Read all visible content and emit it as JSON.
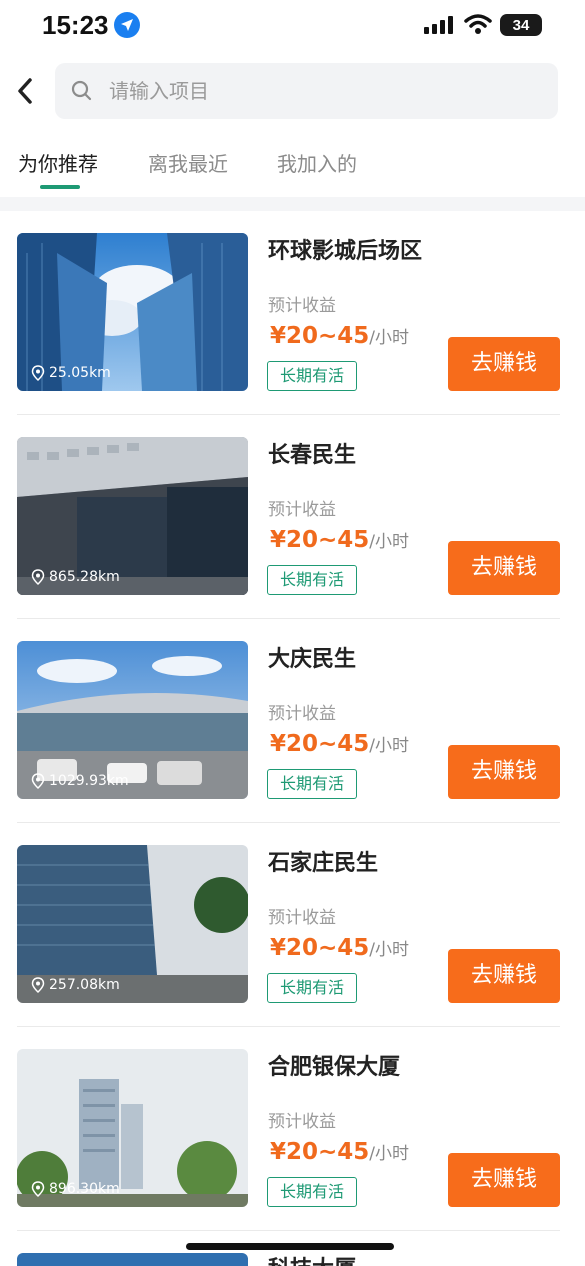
{
  "status_bar": {
    "time": "15:23",
    "battery": "34"
  },
  "search": {
    "placeholder": "请输入项目"
  },
  "tabs": [
    {
      "label": "为你推荐",
      "active": true
    },
    {
      "label": "离我最近",
      "active": false
    },
    {
      "label": "我加入的",
      "active": false
    }
  ],
  "items": [
    {
      "title": "环球影城后场区",
      "distance": "25.05km",
      "earnings_label": "预计收益",
      "price": "¥20~45",
      "unit": "/小时",
      "tag": "长期有活",
      "button": "去赚钱"
    },
    {
      "title": "长春民生",
      "distance": "865.28km",
      "earnings_label": "预计收益",
      "price": "¥20~45",
      "unit": "/小时",
      "tag": "长期有活",
      "button": "去赚钱"
    },
    {
      "title": "大庆民生",
      "distance": "1029.93km",
      "earnings_label": "预计收益",
      "price": "¥20~45",
      "unit": "/小时",
      "tag": "长期有活",
      "button": "去赚钱"
    },
    {
      "title": "石家庄民生",
      "distance": "257.08km",
      "earnings_label": "预计收益",
      "price": "¥20~45",
      "unit": "/小时",
      "tag": "长期有活",
      "button": "去赚钱"
    },
    {
      "title": "合肥银保大厦",
      "distance": "896.30km",
      "earnings_label": "预计收益",
      "price": "¥20~45",
      "unit": "/小时",
      "tag": "长期有活",
      "button": "去赚钱"
    }
  ],
  "partial_item": {
    "title": "科技大厦"
  },
  "colors": {
    "accent_green": "#1e9a74",
    "orange": "#f76c1b",
    "price_orange": "#f06a1d"
  }
}
